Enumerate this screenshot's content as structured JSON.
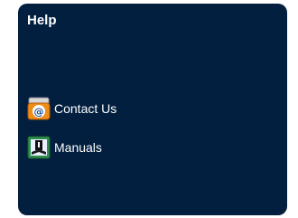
{
  "help_panel": {
    "title": "Help",
    "links": [
      {
        "label": "Contact Us",
        "icon": "email-at-icon"
      },
      {
        "label": "Manuals",
        "icon": "manual-book-icon"
      }
    ]
  },
  "colors": {
    "panel_background": "#021f3f",
    "text": "#ffffff",
    "email_icon_orange": "#f08c1a",
    "manual_icon_green": "#2f8f4e"
  }
}
